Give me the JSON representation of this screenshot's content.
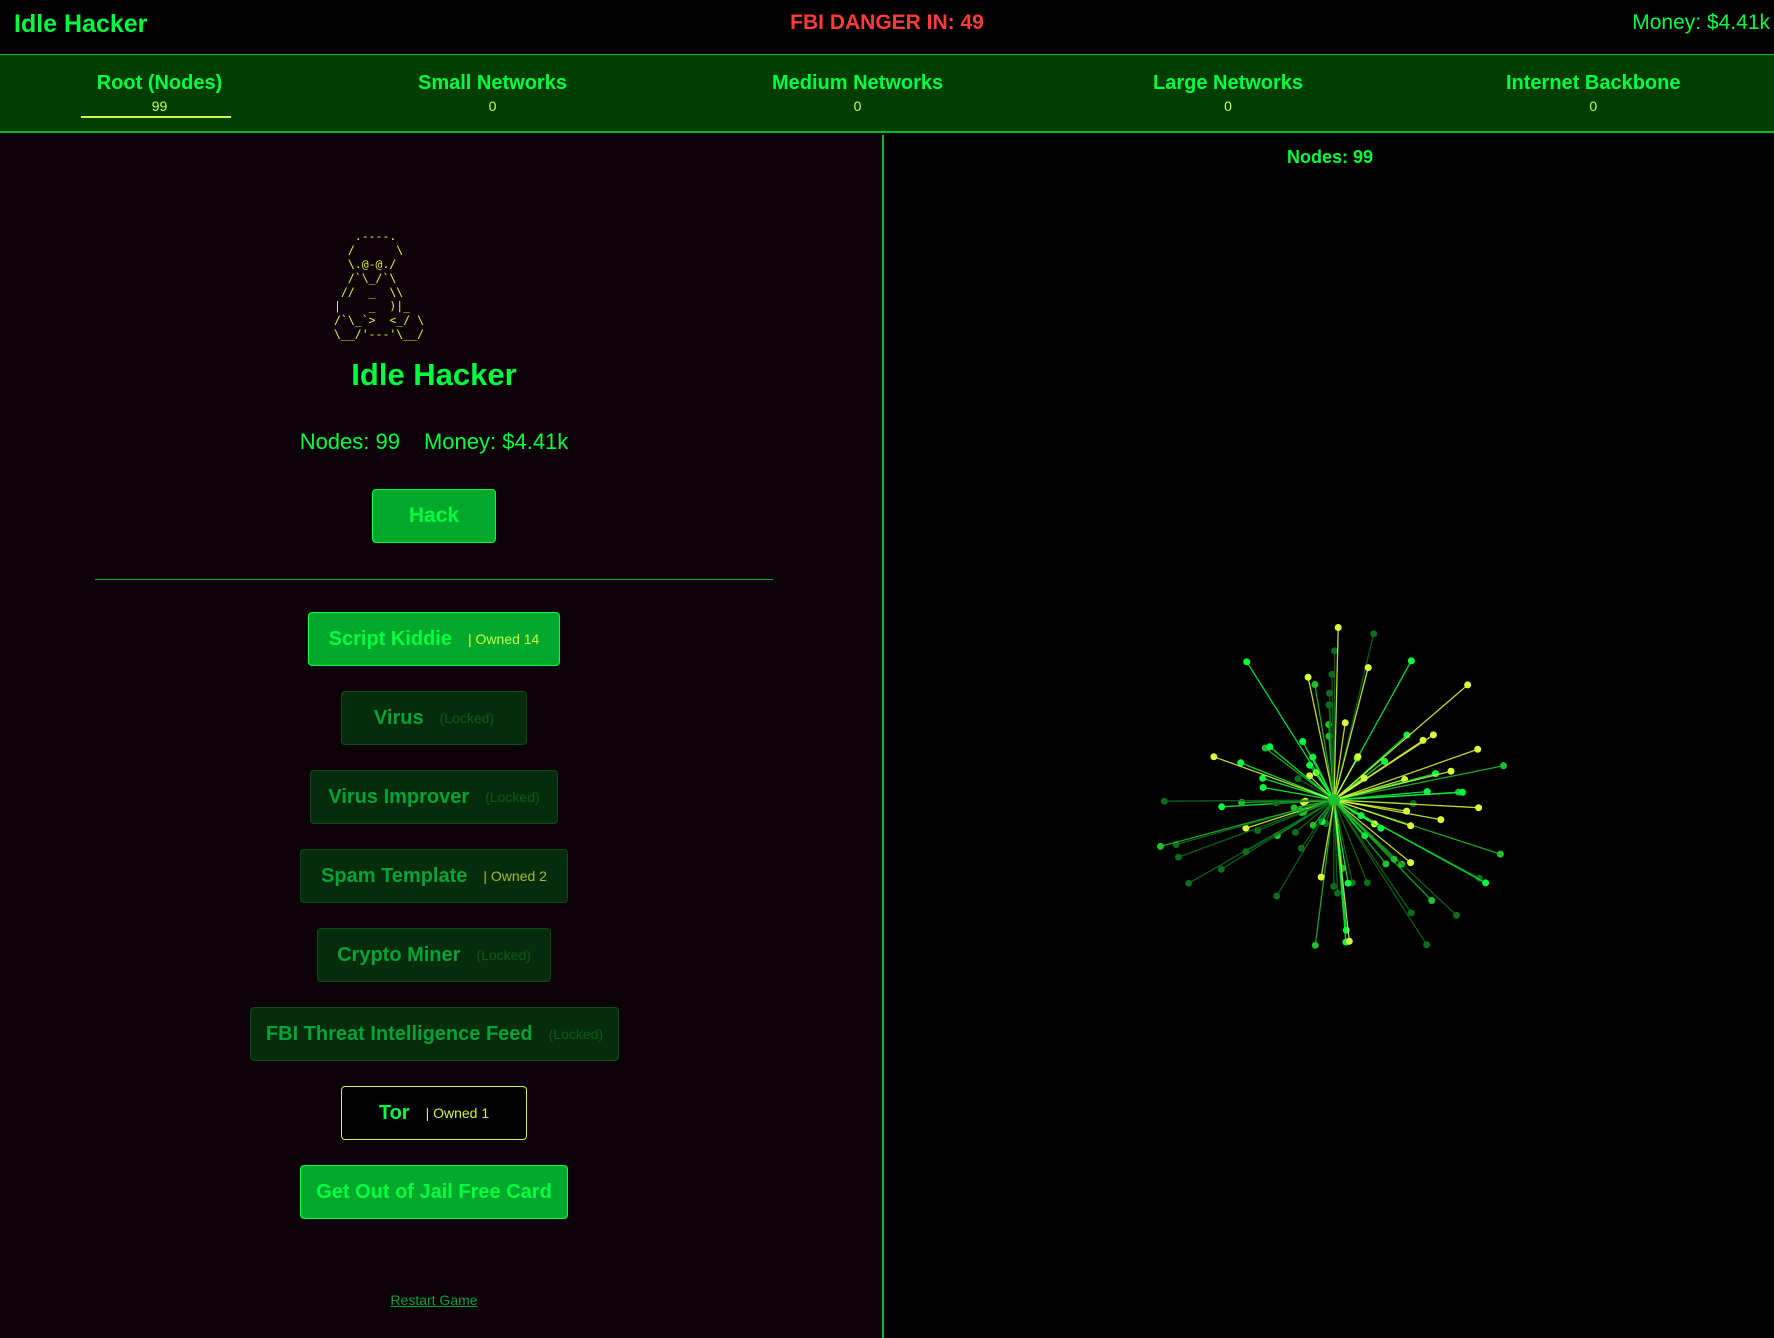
{
  "header": {
    "title": "Idle Hacker",
    "danger": "FBI DANGER IN: 49",
    "money": "Money: $4.41k"
  },
  "tabs": [
    {
      "label": "Root (Nodes)",
      "count": "99",
      "active": true
    },
    {
      "label": "Small Networks",
      "count": "0"
    },
    {
      "label": "Medium Networks",
      "count": "0"
    },
    {
      "label": "Large Networks",
      "count": "0"
    },
    {
      "label": "Internet Backbone",
      "count": "0"
    }
  ],
  "main": {
    "ascii_art": "   .----.\n  /      \\\n  \\.@-@./\n  /`\\_/`\\\n //  _  \\\\\n|    _  )|_\n/`\\_`>  <_/ \\\n\\__/'---'\\__/",
    "title": "Idle Hacker",
    "nodes": "Nodes: 99",
    "money": "Money: $4.41k",
    "hack_label": "Hack",
    "restart_label": "Restart Game"
  },
  "upgrades": [
    {
      "name": "Script Kiddie",
      "status": "| Owned 14"
    },
    {
      "name": "Virus",
      "status": "(Locked)"
    },
    {
      "name": "Virus Improver",
      "status": "(Locked)"
    },
    {
      "name": "Spam Template",
      "status": "| Owned 2"
    },
    {
      "name": "Crypto Miner",
      "status": "(Locked)"
    },
    {
      "name": "FBI Threat Intelligence Feed",
      "status": "(Locked)"
    },
    {
      "name": "Tor",
      "status": "| Owned 1"
    },
    {
      "name": "Get Out of Jail Free Card",
      "status": ""
    }
  ],
  "network": {
    "label": "Nodes: 99",
    "node_count": 99,
    "colors": {
      "bright": "#00ff41",
      "yellow": "#d8ff3a",
      "dim": "#0c6d1c",
      "mid": "#1fbf2d"
    }
  }
}
